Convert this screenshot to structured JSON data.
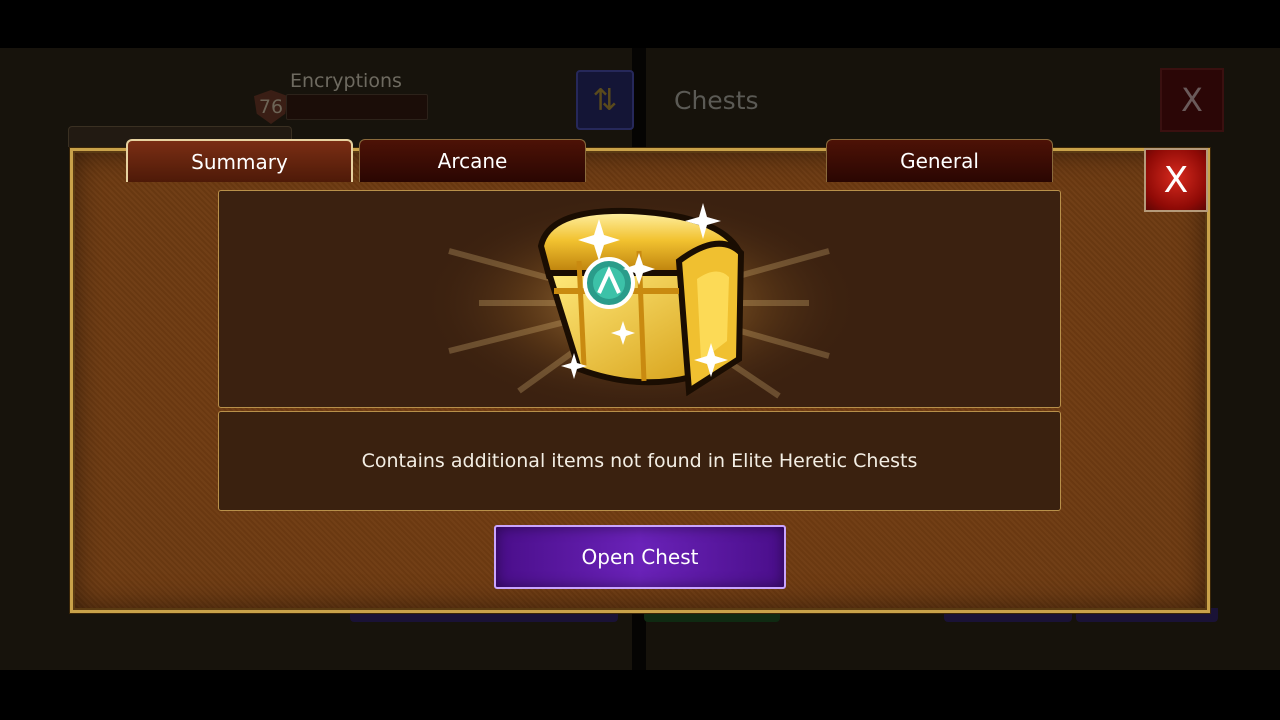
{
  "background": {
    "encryptions_label": "Encryptions",
    "player_level": "76",
    "panel_title": "Chests",
    "close_label": "X"
  },
  "modal": {
    "tabs": [
      {
        "label": "Summary",
        "active": true
      },
      {
        "label": "Arcane",
        "active": false
      },
      {
        "label": "General",
        "active": false
      }
    ],
    "close_label": "X",
    "description": "Contains additional items not found in Elite Heretic Chests",
    "open_button": "Open Chest",
    "chest_icon": "golden-chest-icon"
  },
  "colors": {
    "modal_bg": "#6e3b12",
    "modal_border": "#c9a24a",
    "button_purple": "#5b1aa3",
    "close_red": "#c21a12"
  }
}
